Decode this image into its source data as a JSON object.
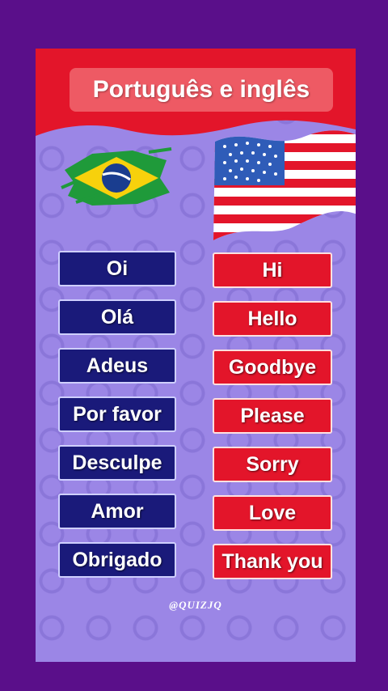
{
  "header": {
    "title": "Português e inglês"
  },
  "flags": {
    "portuguese": "brazil-flag",
    "english": "usa-flag"
  },
  "colors": {
    "background": "#5a0f8a",
    "card": "#9b86e6",
    "header": "#e3152a",
    "portuguese_box": "#1a1a7a",
    "english_box": "#e3152a"
  },
  "words": [
    {
      "pt": "Oi",
      "en": "Hi"
    },
    {
      "pt": "Olá",
      "en": "Hello"
    },
    {
      "pt": "Adeus",
      "en": "Goodbye"
    },
    {
      "pt": "Por favor",
      "en": "Please"
    },
    {
      "pt": "Desculpe",
      "en": "Sorry"
    },
    {
      "pt": "Amor",
      "en": "Love"
    },
    {
      "pt": "Obrigado",
      "en": "Thank you"
    }
  ],
  "watermark": "@QUIZJQ"
}
